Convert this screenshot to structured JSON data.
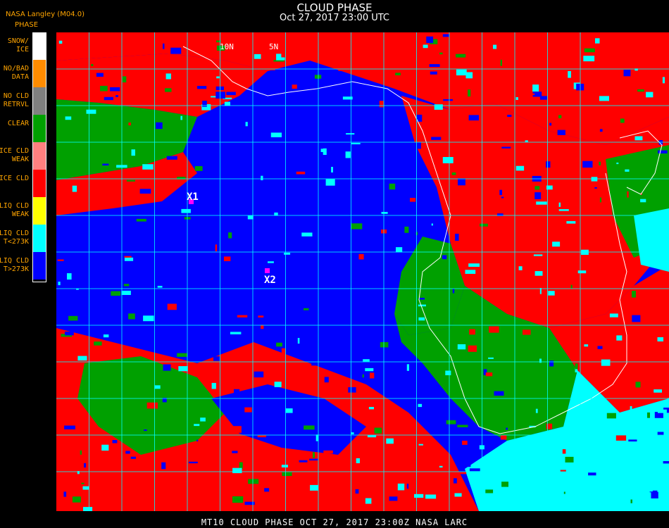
{
  "header": {
    "source": "NASA Langley (M04.0)",
    "legend_title": "PHASE",
    "title": "CLOUD PHASE",
    "datetime": "Oct 27, 2017 23:00 UTC"
  },
  "legend": [
    {
      "label": "SNOW/\nICE",
      "color": "#ffffff"
    },
    {
      "label": "NO/BAD\nDATA",
      "color": "#ff8c00"
    },
    {
      "label": "NO CLD\nRETRVL",
      "color": "#808080"
    },
    {
      "label": "CLEAR",
      "color": "#00a000"
    },
    {
      "label": "ICE CLD\nWEAK",
      "color": "#ff8080"
    },
    {
      "label": "ICE CLD",
      "color": "#ff0000"
    },
    {
      "label": "LIQ CLD\nWEAK",
      "color": "#ffff00"
    },
    {
      "label": "LIQ CLD\nT<273K",
      "color": "#00ffff"
    },
    {
      "label": "LIQ CLD\nT>273K",
      "color": "#0000ff"
    }
  ],
  "map": {
    "grid_color": "#00ffff",
    "coast_color": "#ffffff",
    "grid_labels": [
      "10N",
      "5N"
    ],
    "markers": [
      {
        "label": "X1",
        "color": "#ff00ff"
      },
      {
        "label": "X2",
        "color": "#ff00ff"
      }
    ]
  },
  "footer": "MT10  CLOUD PHASE   OCT 27, 2017 23:00Z   NASA LARC"
}
